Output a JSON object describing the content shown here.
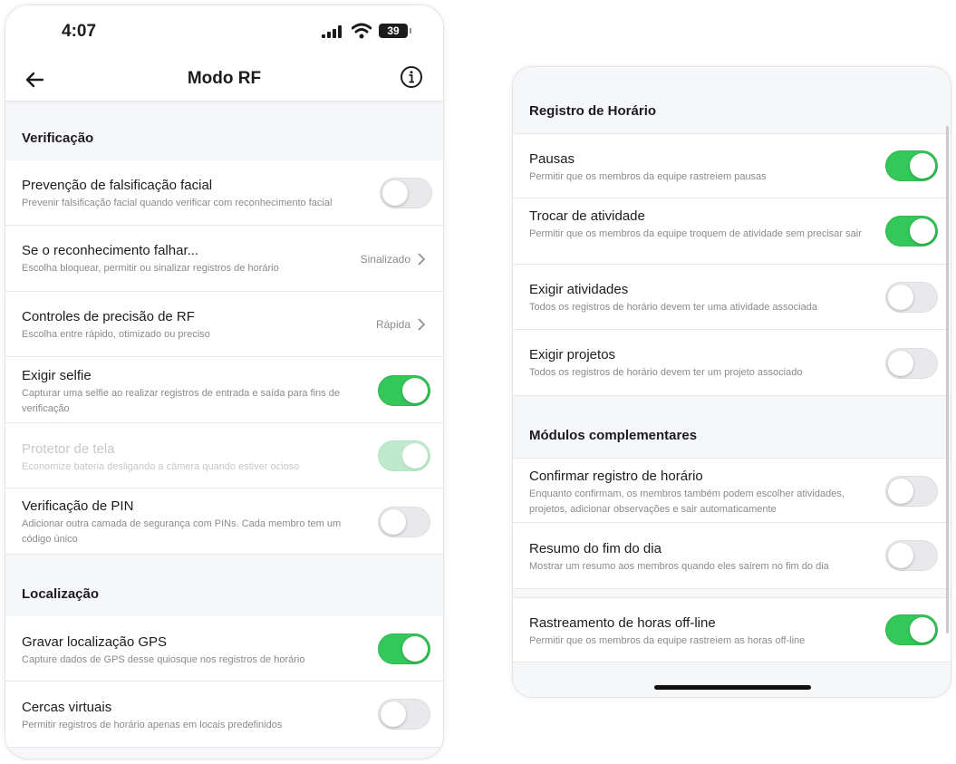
{
  "status": {
    "time": "4:07",
    "battery": "39"
  },
  "nav": {
    "title": "Modo RF"
  },
  "left": {
    "sections": {
      "verificacao": "Verificação",
      "localizacao": "Localização"
    },
    "rows": [
      {
        "title": "Prevenção de falsificação facial",
        "subtitle": "Prevenir falsificação facial quando verificar com reconhecimento facial",
        "toggle": "off"
      },
      {
        "title": "Se o reconhecimento falhar...",
        "subtitle": "Escolha bloquear, permitir ou sinalizar registros de horário",
        "value": "Sinalizado"
      },
      {
        "title": "Controles de precisão de RF",
        "subtitle": "Escolha entre rápido, otimizado ou preciso",
        "value": "Rápida"
      },
      {
        "title": "Exigir selfie",
        "subtitle": "Capturar uma selfie ao realizar registros de entrada e saída para fins de verificação",
        "toggle": "on"
      },
      {
        "title": "Protetor de tela",
        "subtitle": "Economize bateria desligando a câmera quando estiver ocioso",
        "toggle": "on-disabled"
      },
      {
        "title": "Verificação de PIN",
        "subtitle": "Adicionar outra camada de segurança com PINs. Cada membro tem um código único",
        "toggle": "off"
      },
      {
        "title": "Gravar localização GPS",
        "subtitle": "Capture dados de GPS desse quiosque nos registros de horário",
        "toggle": "on"
      },
      {
        "title": "Cercas virtuais",
        "subtitle": "Permitir registros de horário apenas em locais predefinidos",
        "toggle": "off"
      }
    ]
  },
  "right": {
    "sections": {
      "registro": "Registro de Horário",
      "modulos": "Módulos complementares"
    },
    "rows": [
      {
        "title": "Pausas",
        "subtitle": "Permitir que os membros da equipe rastreiem pausas",
        "toggle": "on"
      },
      {
        "title": "Trocar de atividade",
        "subtitle": "Permitir que os membros da equipe troquem de atividade sem precisar sair",
        "toggle": "on"
      },
      {
        "title": "Exigir atividades",
        "subtitle": "Todos os registros de horário devem ter uma atividade associada",
        "toggle": "off"
      },
      {
        "title": "Exigir projetos",
        "subtitle": "Todos os registros de horário devem ter um projeto associado",
        "toggle": "off"
      },
      {
        "title": "Confirmar registro de horário",
        "subtitle": "Enquanto confirmam, os membros também podem escolher atividades, projetos, adicionar observações e sair automaticamente",
        "toggle": "off"
      },
      {
        "title": "Resumo do fim do dia",
        "subtitle": "Mostrar um resumo aos membros quando eles saírem no fim do dia",
        "toggle": "off"
      },
      {
        "title": "Rastreamento de horas off-line",
        "subtitle": "Permitir que os membros da equipe rastreiem as horas off-line",
        "toggle": "on"
      }
    ]
  },
  "colors": {
    "toggle_on": "#34c759",
    "toggle_off": "#e9e9eb",
    "toggle_disabled": "#bfe9ca",
    "background": "#f6f7f9"
  }
}
